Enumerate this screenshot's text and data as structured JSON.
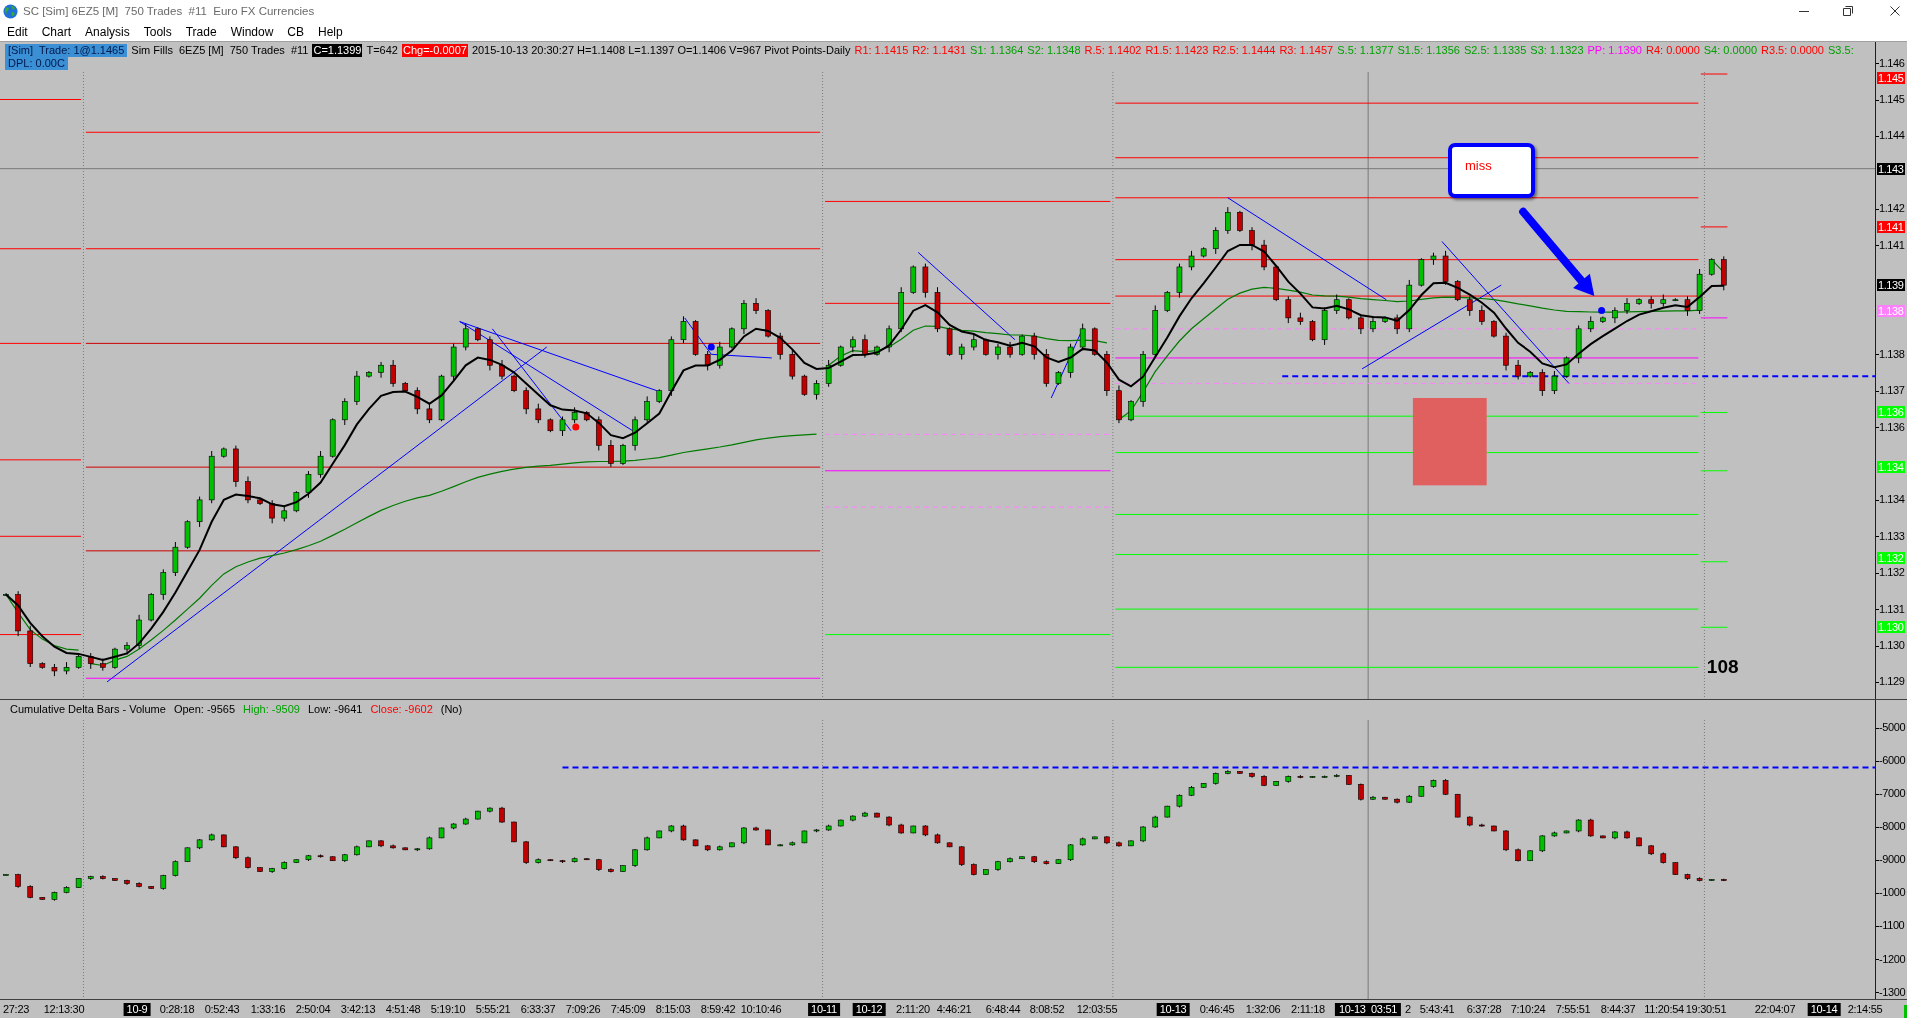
{
  "window": {
    "title": "SC [Sim] 6EZ5 [M]  750 Trades  #11  Euro FX Currencies"
  },
  "menu": [
    "Edit",
    "Chart",
    "Analysis",
    "Tools",
    "Trade",
    "Window",
    "CB",
    "Help"
  ],
  "info_bar": {
    "lines": [
      [
        {
          "kind": "status",
          "text": "[Sim]  Trade: 1@1.1465"
        },
        {
          "kind": "text",
          "text": "Sim Fills  6EZ5 [M]  750 Trades  #11"
        },
        {
          "kind": "price",
          "text": "C=1.1399"
        },
        {
          "kind": "text",
          "text": "T=642"
        },
        {
          "kind": "change",
          "text": "Chg=-0.0007"
        },
        {
          "kind": "text",
          "text": "2015-10-13 20:30:27 H=1.1408 L=1.1397 O=1.1406 V=967 Pivot Points-Daily"
        },
        {
          "kind": "level",
          "text": "R1: 1.1415",
          "color": "#ff0000"
        },
        {
          "kind": "level",
          "text": "R2: 1.1431",
          "color": "#ff0000"
        },
        {
          "kind": "level",
          "text": "S1: 1.1364",
          "color": "#00a000"
        },
        {
          "kind": "level",
          "text": "S2: 1.1348",
          "color": "#00a000"
        },
        {
          "kind": "level",
          "text": "R.5: 1.1402",
          "color": "#ff0000"
        },
        {
          "kind": "level",
          "text": "R1.5: 1.1423",
          "color": "#ff0000"
        },
        {
          "kind": "level",
          "text": "R2.5: 1.1444",
          "color": "#ff0000"
        },
        {
          "kind": "level",
          "text": "R3: 1.1457",
          "color": "#ff0000"
        },
        {
          "kind": "level",
          "text": "S.5: 1.1377",
          "color": "#00a000"
        },
        {
          "kind": "level",
          "text": "S1.5: 1.1356",
          "color": "#00a000"
        },
        {
          "kind": "level",
          "text": "S2.5: 1.1335",
          "color": "#00a000"
        },
        {
          "kind": "level",
          "text": "S3: 1.1323",
          "color": "#00a000"
        },
        {
          "kind": "level",
          "text": "PP: 1.1390",
          "color": "#ff00ff"
        },
        {
          "kind": "level",
          "text": "R4: 0.0000",
          "color": "#ff0000"
        },
        {
          "kind": "level",
          "text": "S4: 0.0000",
          "color": "#00a000"
        },
        {
          "kind": "level",
          "text": "R3.5: 0.0000",
          "color": "#ff0000"
        },
        {
          "kind": "level",
          "text": "S3.5:",
          "color": "#00a000"
        }
      ],
      [
        {
          "kind": "status",
          "text": "DPL: 0.00C"
        }
      ]
    ]
  },
  "price_chart": {
    "callout": "miss",
    "bar_countdown": "108",
    "price_axis": {
      "labels": [
        "1.146",
        "1.145",
        "1.144",
        "1.142",
        "1.141",
        "1.138",
        "1.137",
        "1.136",
        "1.134",
        "1.133",
        "1.132",
        "1.131",
        "1.130",
        "1.129"
      ],
      "markers": [
        {
          "label": "1.145",
          "color": "#ff0000"
        },
        {
          "label": "1.143",
          "color": "#000000"
        },
        {
          "label": "1.141",
          "color": "#ff0000"
        },
        {
          "label": "1.139",
          "color": "#000000"
        },
        {
          "label": "1.138",
          "color": "#ff80ff"
        },
        {
          "label": "1.136",
          "color": "#00ff00"
        },
        {
          "label": "1.134",
          "color": "#00ff00"
        },
        {
          "label": "1.132",
          "color": "#00ff00"
        },
        {
          "label": "1.130",
          "color": "#00ff00"
        }
      ]
    }
  },
  "delta_chart": {
    "header": [
      {
        "text": "Cumulative Delta Bars - Volume"
      },
      {
        "text": "Open: -9565"
      },
      {
        "text": "High: -9509",
        "color": "#00a000"
      },
      {
        "text": "Low: -9641"
      },
      {
        "text": "Close: -9602",
        "color": "#ff0000"
      },
      {
        "text": "(No)"
      }
    ],
    "value_axis": [
      "-5000",
      "-6000",
      "-7000",
      "-8000",
      "-9000",
      "-1000",
      "-1100",
      "-1200",
      "-1300"
    ]
  },
  "time_axis": [
    {
      "kind": "time",
      "label": "27:23"
    },
    {
      "kind": "time",
      "label": "12:13:30"
    },
    {
      "kind": "date",
      "label": "10-9"
    },
    {
      "kind": "time",
      "label": "0:28:18"
    },
    {
      "kind": "time",
      "label": "0:52:43"
    },
    {
      "kind": "time",
      "label": "1:33:16"
    },
    {
      "kind": "time",
      "label": "2:50:04"
    },
    {
      "kind": "time",
      "label": "3:42:13"
    },
    {
      "kind": "time",
      "label": "4:51:48"
    },
    {
      "kind": "time",
      "label": "5:19:10"
    },
    {
      "kind": "time",
      "label": "5:55:21"
    },
    {
      "kind": "time",
      "label": "6:33:37"
    },
    {
      "kind": "time",
      "label": "7:09:26"
    },
    {
      "kind": "time",
      "label": "7:45:09"
    },
    {
      "kind": "time",
      "label": "8:15:03"
    },
    {
      "kind": "time",
      "label": "8:59:42"
    },
    {
      "kind": "time",
      "label": "10:10:46"
    },
    {
      "kind": "date",
      "label": "10-11"
    },
    {
      "kind": "date",
      "label": "10-12"
    },
    {
      "kind": "time",
      "label": "2:11:20"
    },
    {
      "kind": "time",
      "label": "4:46:21"
    },
    {
      "kind": "time",
      "label": "6:48:44"
    },
    {
      "kind": "time",
      "label": "8:08:52"
    },
    {
      "kind": "time",
      "label": "12:03:55"
    },
    {
      "kind": "date",
      "label": "10-13"
    },
    {
      "kind": "time",
      "label": "0:46:45"
    },
    {
      "kind": "time",
      "label": "1:32:06"
    },
    {
      "kind": "time",
      "label": "2:11:18"
    },
    {
      "kind": "crosshair",
      "label": "10-13  03:51"
    },
    {
      "kind": "time",
      "label": "2"
    },
    {
      "kind": "time",
      "label": "5:43:41"
    },
    {
      "kind": "time",
      "label": "6:37:28"
    },
    {
      "kind": "time",
      "label": "7:10:24"
    },
    {
      "kind": "time",
      "label": "7:55:51"
    },
    {
      "kind": "time",
      "label": "8:44:37"
    },
    {
      "kind": "time",
      "label": "11:20:54"
    },
    {
      "kind": "time",
      "label": "19:30:51"
    },
    {
      "kind": "time",
      "label": "22:04:07"
    },
    {
      "kind": "date",
      "label": "10-14"
    },
    {
      "kind": "time",
      "label": "2:14:55"
    }
  ]
}
